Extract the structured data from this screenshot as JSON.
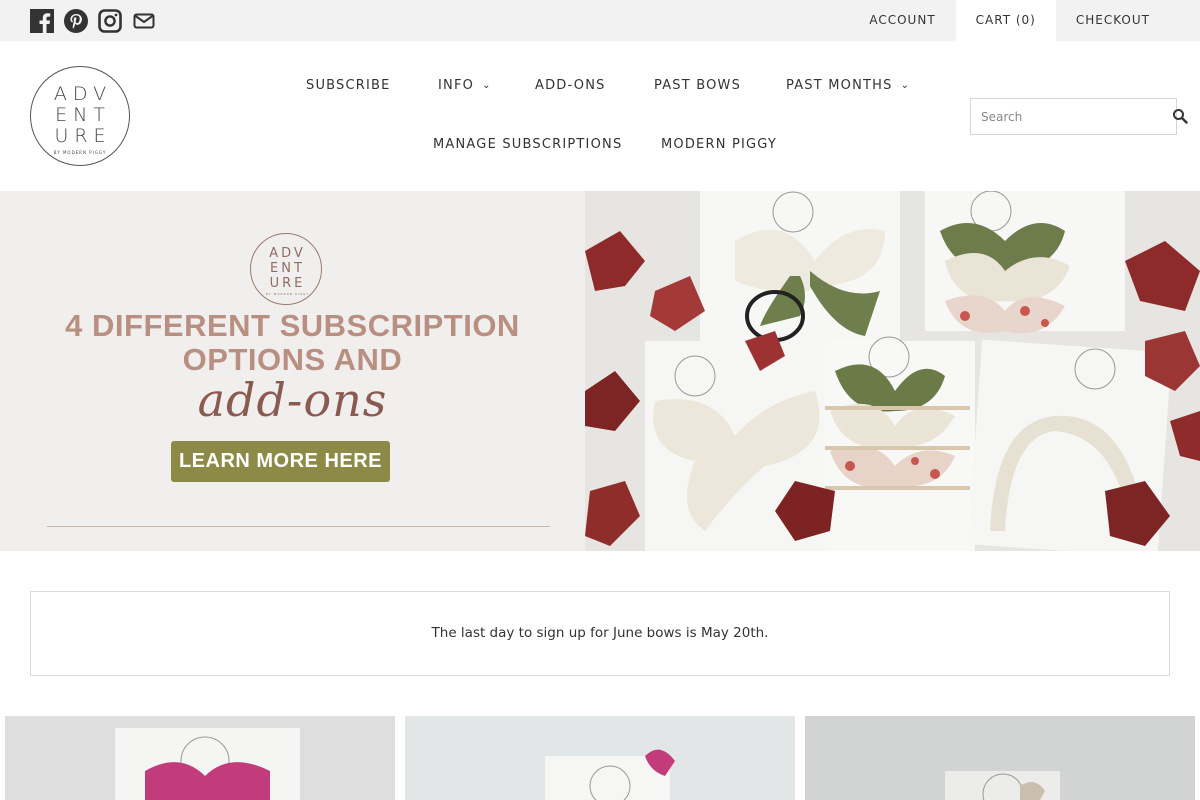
{
  "topbar": {
    "social_icons": [
      "facebook-icon",
      "pinterest-icon",
      "instagram-icon",
      "email-icon"
    ],
    "links": {
      "account": "ACCOUNT",
      "cart": "CART (0)",
      "checkout": "CHECKOUT"
    }
  },
  "logo": {
    "line1": "ADV",
    "line2": "ENT",
    "line3": "URE",
    "tagline": "BY MODERN PIGGY"
  },
  "nav": {
    "items": [
      {
        "label": "SUBSCRIBE",
        "has_dropdown": false
      },
      {
        "label": "INFO",
        "has_dropdown": true
      },
      {
        "label": "ADD-ONS",
        "has_dropdown": false
      },
      {
        "label": "PAST BOWS",
        "has_dropdown": false
      },
      {
        "label": "PAST MONTHS",
        "has_dropdown": true
      },
      {
        "label": "MANAGE SUBSCRIPTIONS",
        "has_dropdown": false
      },
      {
        "label": "MODERN PIGGY",
        "has_dropdown": false
      }
    ],
    "chevron": "⌄"
  },
  "search": {
    "placeholder": "Search",
    "icon": "search-icon"
  },
  "hero": {
    "logo_line1": "ADV",
    "logo_line2": "ENT",
    "logo_line3": "URE",
    "logo_tagline": "BY MODERN PIGGY",
    "headline_line1": "4 DIFFERENT SUBSCRIPTION",
    "headline_line2": "OPTIONS AND",
    "script_text": "add-ons",
    "button_label": "LEARN MORE HERE",
    "colors": {
      "headline": "#b88f80",
      "script": "#8a5a51",
      "button": "#8d8a48",
      "background": "#f0efee"
    }
  },
  "notice": {
    "text": "The last day to sign up for June bows is May 20th."
  },
  "products": {
    "tiles": [
      "product-tile-pink-bow",
      "product-tile-pink-bow-small",
      "product-tile-neutral-bow"
    ]
  }
}
